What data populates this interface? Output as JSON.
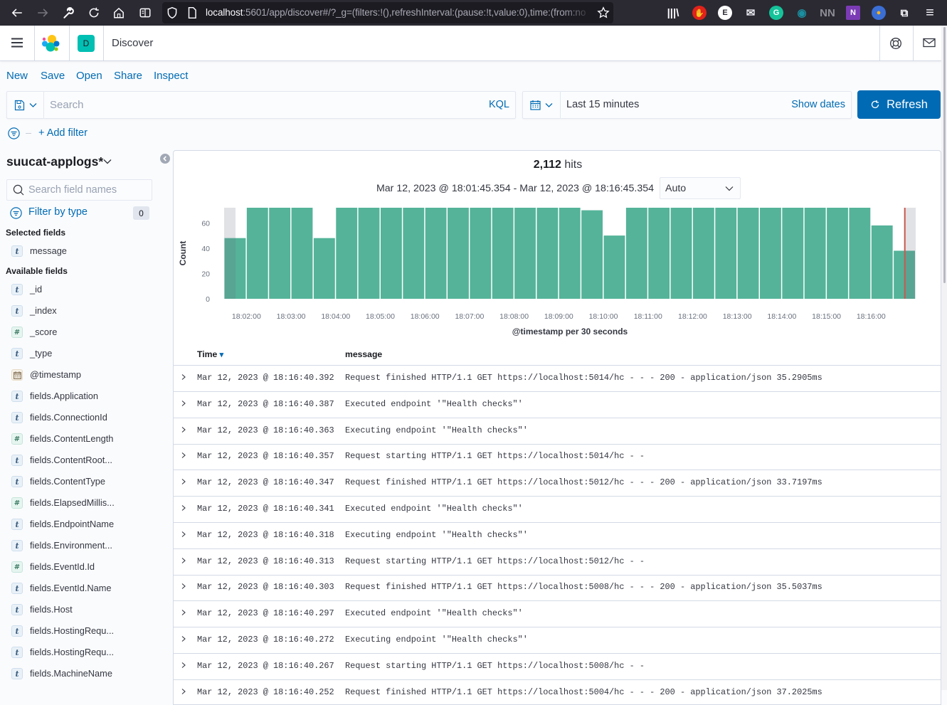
{
  "browser": {
    "url_host": "localhost",
    "url_rest": ":5601/app/discover#/?_g=(filters:!(),refreshInterval:(pause:!t,value:0),time:(from:no",
    "nav_icons": [
      "back-icon",
      "forward-icon",
      "wrench-icon",
      "reload-icon",
      "home-icon",
      "reader-view-icon"
    ],
    "extensions": [
      {
        "name": "library-icon",
        "glyph": "|||\\",
        "bg": "",
        "fg": "#fbfbfe"
      },
      {
        "name": "adblock-icon",
        "glyph": "✋",
        "bg": "#e0221b",
        "fg": "#ffffff"
      },
      {
        "name": "evernote-e-icon",
        "glyph": "E",
        "bg": "#ffffff",
        "fg": "#2b2a33"
      },
      {
        "name": "mail-extension-icon",
        "glyph": "✉",
        "bg": "",
        "fg": "#e8e8ee"
      },
      {
        "name": "grammarly-icon",
        "glyph": "G",
        "bg": "#15c39a",
        "fg": "#ffffff"
      },
      {
        "name": "teal-eye-icon",
        "glyph": "◉",
        "bg": "",
        "fg": "#1b8fa0"
      },
      {
        "name": "nn-extension-icon",
        "glyph": "NN",
        "bg": "",
        "fg": "#8d8d96"
      },
      {
        "name": "onenote-icon",
        "glyph": "N",
        "bg": "#7b3bb5",
        "fg": "#ffffff"
      },
      {
        "name": "colorful-globe-icon",
        "glyph": "●",
        "bg": "#3b6fd6",
        "fg": "#f5b21b"
      },
      {
        "name": "extensions-puzzle-icon",
        "glyph": "⧉",
        "bg": "",
        "fg": "#fbfbfe"
      },
      {
        "name": "browser-menu-icon",
        "glyph": "≡",
        "bg": "",
        "fg": "#fbfbfe"
      }
    ]
  },
  "header": {
    "space_initial": "D",
    "title": "Discover"
  },
  "top_nav": [
    {
      "label": "New"
    },
    {
      "label": "Save"
    },
    {
      "label": "Open"
    },
    {
      "label": "Share"
    },
    {
      "label": "Inspect"
    }
  ],
  "query_bar": {
    "search_placeholder": "Search",
    "search_value": "",
    "language": "KQL",
    "time_range": "Last 15 minutes",
    "show_dates": "Show dates",
    "refresh": "Refresh"
  },
  "filter_bar": {
    "add_filter": "+ Add filter"
  },
  "sidebar": {
    "index_pattern": "suucat-applogs*",
    "search_placeholder": "Search field names",
    "filter_by_type": "Filter by type",
    "filter_count": "0",
    "selected_heading": "Selected fields",
    "selected_fields": [
      {
        "type": "string",
        "glyph": "t",
        "name": "message"
      }
    ],
    "available_heading": "Available fields",
    "available_fields": [
      {
        "type": "string",
        "glyph": "t",
        "name": "_id"
      },
      {
        "type": "string",
        "glyph": "t",
        "name": "_index"
      },
      {
        "type": "number",
        "glyph": "#",
        "name": "_score"
      },
      {
        "type": "string",
        "glyph": "t",
        "name": "_type"
      },
      {
        "type": "date",
        "glyph": "",
        "name": "@timestamp"
      },
      {
        "type": "string",
        "glyph": "t",
        "name": "fields.Application"
      },
      {
        "type": "string",
        "glyph": "t",
        "name": "fields.ConnectionId"
      },
      {
        "type": "number",
        "glyph": "#",
        "name": "fields.ContentLength"
      },
      {
        "type": "string",
        "glyph": "t",
        "name": "fields.ContentRoot..."
      },
      {
        "type": "string",
        "glyph": "t",
        "name": "fields.ContentType"
      },
      {
        "type": "number",
        "glyph": "#",
        "name": "fields.ElapsedMillis..."
      },
      {
        "type": "string",
        "glyph": "t",
        "name": "fields.EndpointName"
      },
      {
        "type": "string",
        "glyph": "t",
        "name": "fields.Environment..."
      },
      {
        "type": "number",
        "glyph": "#",
        "name": "fields.EventId.Id"
      },
      {
        "type": "string",
        "glyph": "t",
        "name": "fields.EventId.Name"
      },
      {
        "type": "string",
        "glyph": "t",
        "name": "fields.Host"
      },
      {
        "type": "string",
        "glyph": "t",
        "name": "fields.HostingRequ..."
      },
      {
        "type": "string",
        "glyph": "t",
        "name": "fields.HostingRequ..."
      },
      {
        "type": "string",
        "glyph": "t",
        "name": "fields.MachineName"
      }
    ]
  },
  "results": {
    "hits_count": "2,112",
    "hits_label": "hits",
    "range": "Mar 12, 2023 @ 18:01:45.354 - Mar 12, 2023 @ 18:16:45.354",
    "interval": "Auto",
    "columns": {
      "time": "Time",
      "message": "message"
    },
    "sort_indicator": "▾",
    "rows": [
      {
        "time": "Mar 12, 2023 @ 18:16:40.392",
        "message": "Request finished HTTP/1.1 GET https://localhost:5014/hc - - - 200 - application/json 35.2905ms"
      },
      {
        "time": "Mar 12, 2023 @ 18:16:40.387",
        "message": "Executed endpoint '\"Health checks\"'"
      },
      {
        "time": "Mar 12, 2023 @ 18:16:40.363",
        "message": "Executing endpoint '\"Health checks\"'"
      },
      {
        "time": "Mar 12, 2023 @ 18:16:40.357",
        "message": "Request starting HTTP/1.1 GET https://localhost:5014/hc - -"
      },
      {
        "time": "Mar 12, 2023 @ 18:16:40.347",
        "message": "Request finished HTTP/1.1 GET https://localhost:5012/hc - - - 200 - application/json 33.7197ms"
      },
      {
        "time": "Mar 12, 2023 @ 18:16:40.341",
        "message": "Executed endpoint '\"Health checks\"'"
      },
      {
        "time": "Mar 12, 2023 @ 18:16:40.318",
        "message": "Executing endpoint '\"Health checks\"'"
      },
      {
        "time": "Mar 12, 2023 @ 18:16:40.313",
        "message": "Request starting HTTP/1.1 GET https://localhost:5012/hc - -"
      },
      {
        "time": "Mar 12, 2023 @ 18:16:40.303",
        "message": "Request finished HTTP/1.1 GET https://localhost:5008/hc - - - 200 - application/json 35.5037ms"
      },
      {
        "time": "Mar 12, 2023 @ 18:16:40.297",
        "message": "Executed endpoint '\"Health checks\"'"
      },
      {
        "time": "Mar 12, 2023 @ 18:16:40.272",
        "message": "Executing endpoint '\"Health checks\"'"
      },
      {
        "time": "Mar 12, 2023 @ 18:16:40.267",
        "message": "Request starting HTTP/1.1 GET https://localhost:5008/hc - -"
      },
      {
        "time": "Mar 12, 2023 @ 18:16:40.252",
        "message": "Request finished HTTP/1.1 GET https://localhost:5004/hc - - - 200 - application/json 37.2025ms"
      }
    ]
  },
  "colors": {
    "accent": "#006bb4",
    "bar": "#54b399",
    "now_line": "#c9584d",
    "out_of_range_shade": "rgba(105,112,125,0.2)",
    "space_badge": "#00bfb3"
  },
  "chart_data": {
    "type": "bar",
    "title": "",
    "xlabel": "@timestamp per 30 seconds",
    "ylabel": "Count",
    "interval_seconds": 30,
    "x": [
      "18:01:30",
      "18:02:00",
      "18:02:30",
      "18:03:00",
      "18:03:30",
      "18:04:00",
      "18:04:30",
      "18:05:00",
      "18:05:30",
      "18:06:00",
      "18:06:30",
      "18:07:00",
      "18:07:30",
      "18:08:00",
      "18:08:30",
      "18:09:00",
      "18:09:30",
      "18:10:00",
      "18:10:30",
      "18:11:00",
      "18:11:30",
      "18:12:00",
      "18:12:30",
      "18:13:00",
      "18:13:30",
      "18:14:00",
      "18:14:30",
      "18:15:00",
      "18:15:30",
      "18:16:00",
      "18:16:30"
    ],
    "values": [
      48,
      72,
      72,
      72,
      48,
      72,
      72,
      72,
      72,
      72,
      72,
      72,
      72,
      72,
      72,
      72,
      70,
      50,
      72,
      72,
      72,
      72,
      72,
      72,
      72,
      72,
      72,
      72,
      72,
      58,
      38
    ],
    "xlim": [
      "18:01:30",
      "18:17:00"
    ],
    "ylim": [
      0,
      72
    ],
    "yticks": [
      0,
      20,
      40,
      60
    ],
    "xticks": [
      "18:02:00",
      "18:03:00",
      "18:04:00",
      "18:05:00",
      "18:06:00",
      "18:07:00",
      "18:08:00",
      "18:09:00",
      "18:10:00",
      "18:11:00",
      "18:12:00",
      "18:13:00",
      "18:14:00",
      "18:15:00",
      "18:16:00"
    ],
    "query_range": {
      "start": "18:01:45.354",
      "end": "18:16:45.354"
    },
    "now_marker": "18:16:45.354",
    "grid": false,
    "legend": "none"
  }
}
